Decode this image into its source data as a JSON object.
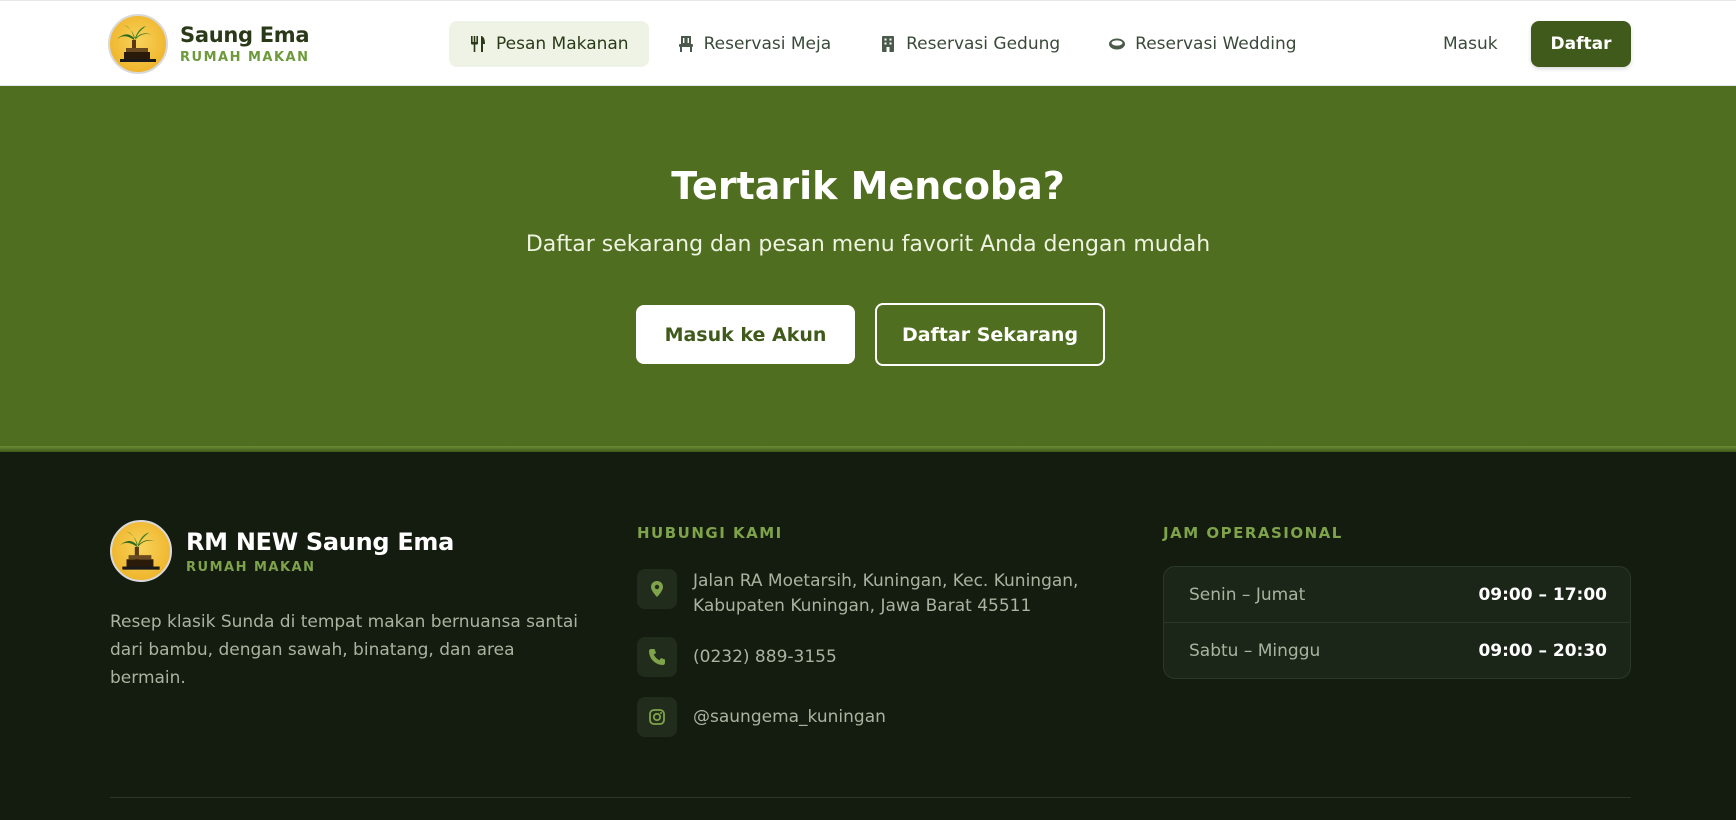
{
  "brand": {
    "name": "Saung Ema",
    "subtitle": "RUMAH MAKAN"
  },
  "nav": {
    "items": [
      {
        "label": "Pesan Makanan",
        "icon": "utensils-icon",
        "active": true
      },
      {
        "label": "Reservasi Meja",
        "icon": "chair-icon",
        "active": false
      },
      {
        "label": "Reservasi Gedung",
        "icon": "building-icon",
        "active": false
      },
      {
        "label": "Reservasi Wedding",
        "icon": "ring-icon",
        "active": false
      }
    ],
    "login_label": "Masuk",
    "register_label": "Daftar"
  },
  "hero": {
    "title": "Tertarik Mencoba?",
    "subtitle": "Daftar sekarang dan pesan menu favorit Anda dengan mudah",
    "login_button": "Masuk ke Akun",
    "register_button": "Daftar Sekarang"
  },
  "footer": {
    "brand_name": "RM NEW Saung Ema",
    "brand_subtitle": "RUMAH MAKAN",
    "description": "Resep klasik Sunda di tempat makan bernuansa santai dari bambu, dengan sawah, binatang, dan area bermain.",
    "contact_heading": "HUBUNGI KAMI",
    "contact": {
      "address_line1": "Jalan RA Moetarsih, Kuningan, Kec. Kuningan,",
      "address_line2": "Kabupaten Kuningan, Jawa Barat 45511",
      "phone": "(0232) 889-3155",
      "instagram": "@saungema_kuningan"
    },
    "hours_heading": "JAM OPERASIONAL",
    "hours": [
      {
        "day": "Senin – Jumat",
        "time": "09:00 – 17:00"
      },
      {
        "day": "Sabtu – Minggu",
        "time": "09:00 – 20:30"
      }
    ]
  },
  "colors": {
    "primary": "#3f5a1a",
    "hero_bg": "#4f6e20",
    "footer_bg": "#141c10",
    "accent": "#7ea34a"
  }
}
